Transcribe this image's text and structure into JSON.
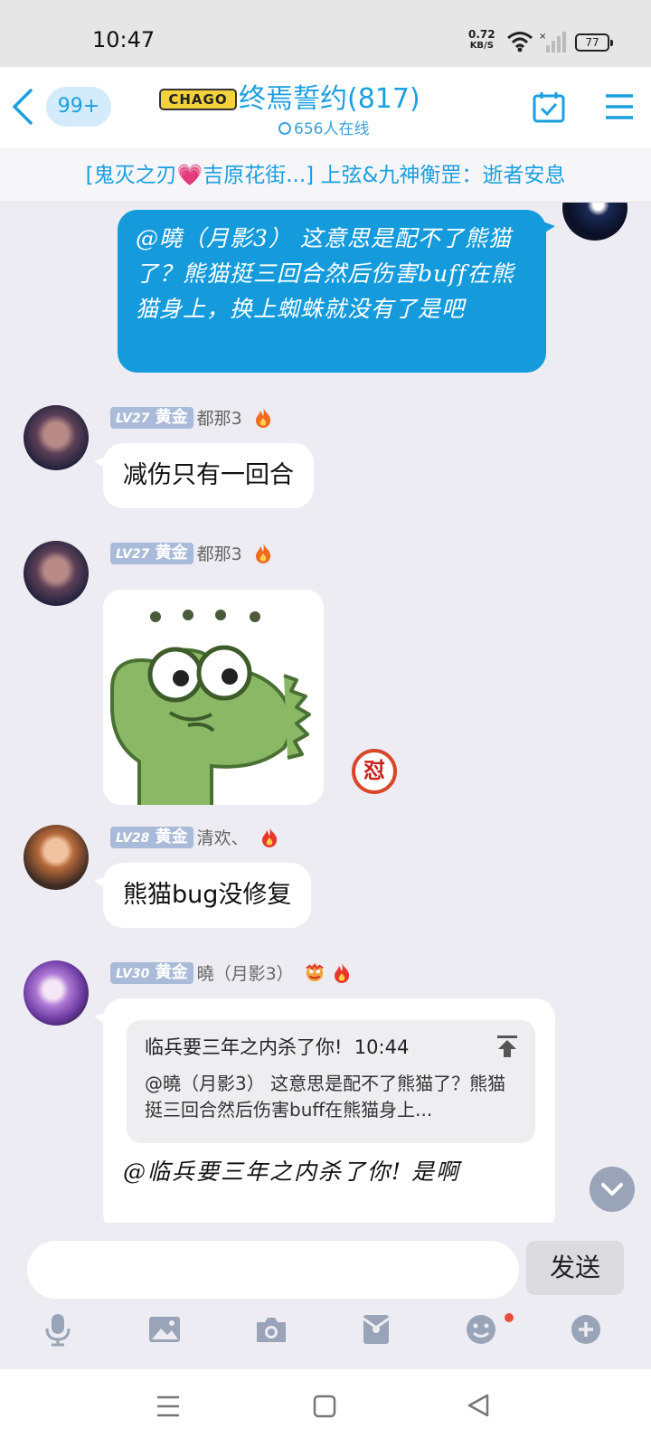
{
  "status_bar": {
    "time": "10:47",
    "net_speed_value": "0.72",
    "net_speed_unit": "KB/S",
    "battery": "77"
  },
  "header": {
    "unread_badge": "99+",
    "logo_text": "CHAGO",
    "group_title": "终焉誓约(817)",
    "online_text": "656人在线"
  },
  "notice": {
    "text": "[鬼灭之刃💗吉原花街...] 上弦&九神衡罡：逝者安息"
  },
  "messages": {
    "self_text": "@曉（月影3） 这意思是配不了熊猫了？熊猫挺三回合然后伤害buff在熊猫身上，换上蜘蛛就没有了是吧",
    "m1": {
      "level": "LV27",
      "rank": "黄金",
      "name": "都那3",
      "text": "减伤只有一回合"
    },
    "m2": {
      "level": "LV27",
      "rank": "黄金",
      "name": "都那3",
      "reaction": "怼"
    },
    "m3": {
      "level": "LV28",
      "rank": "黄金",
      "name": "清欢、",
      "text": "熊猫bug没修复"
    },
    "m4": {
      "level": "LV30",
      "rank": "黄金",
      "name": "曉（月影3）",
      "quote_author": "临兵要三年之内杀了你!",
      "quote_time": "10:44",
      "quote_text": "@曉（月影3） 这意思是配不了熊猫了？熊猫挺三回合然后伤害buff在熊猫身上...",
      "text": "@临兵要三年之内杀了你!  是啊"
    }
  },
  "input": {
    "placeholder": "",
    "send_label": "发送"
  },
  "colors": {
    "accent": "#1a9fe0",
    "self_bubble": "#159bdc",
    "chat_bg": "#ececf2"
  }
}
